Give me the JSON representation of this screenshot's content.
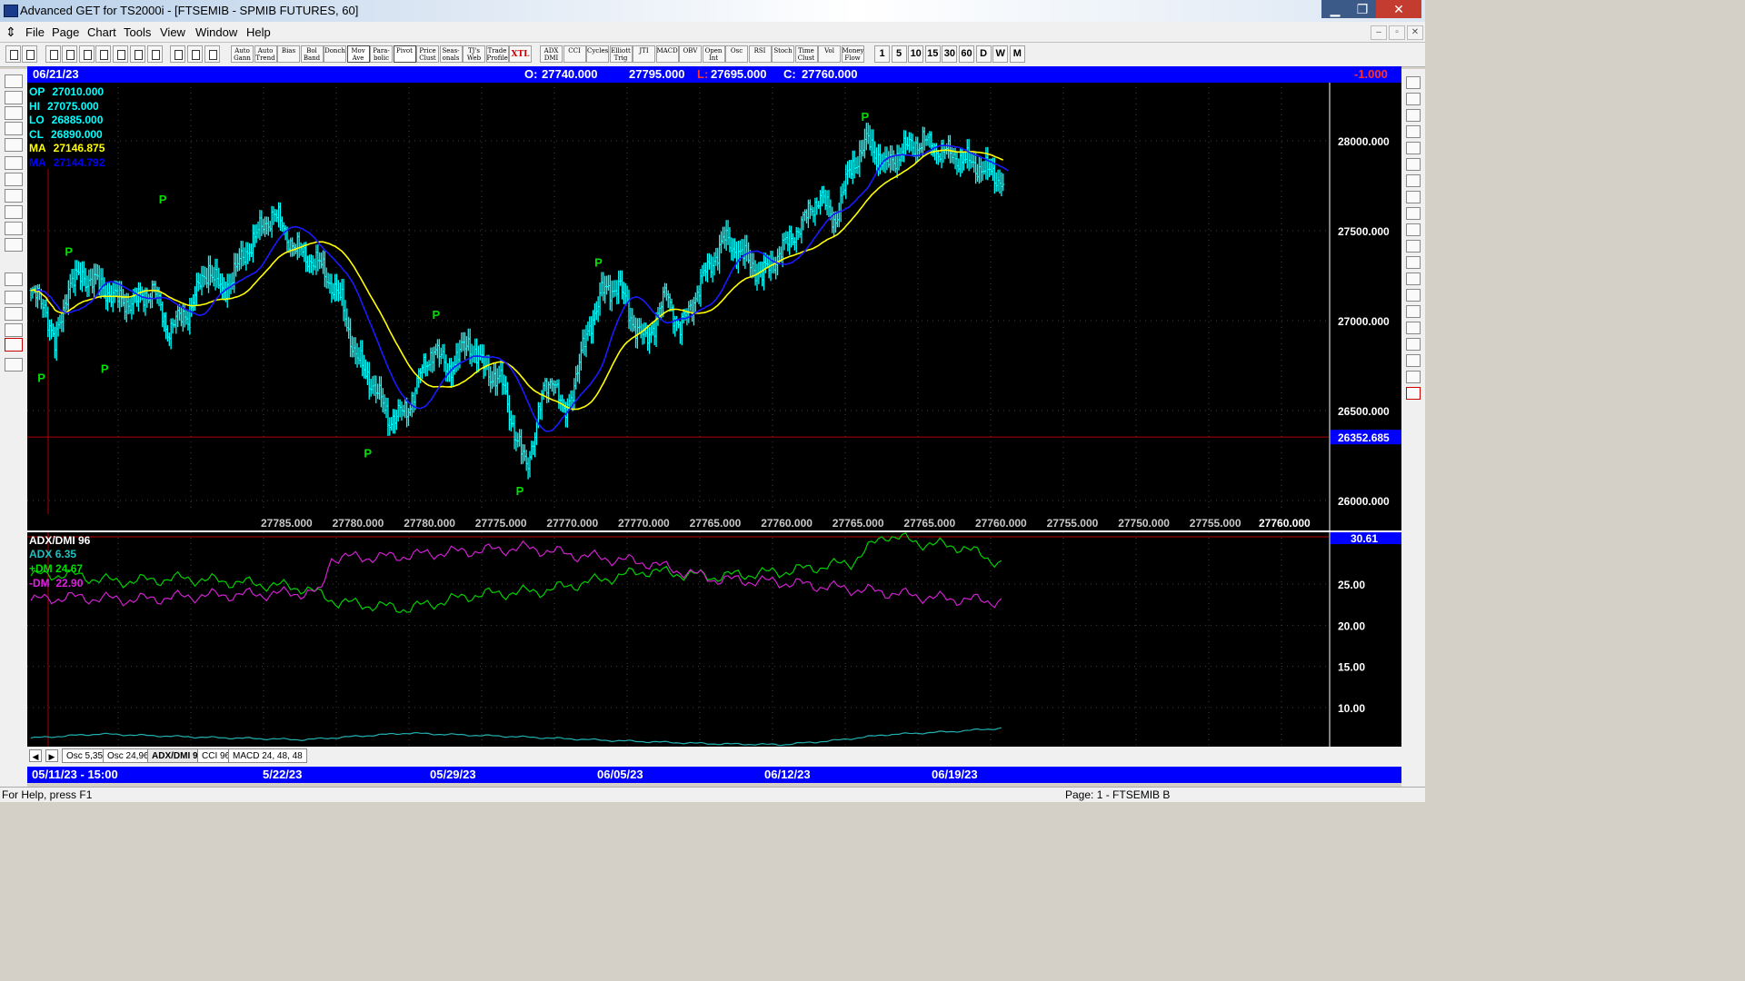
{
  "window": {
    "title": "Advanced GET for TS2000i - [FTSEMIB - SPMIB FUTURES, 60]",
    "minimize": "▁",
    "maximize": "❐",
    "close": "✕"
  },
  "menu": [
    "File",
    "Page",
    "Chart",
    "Tools",
    "View",
    "Window",
    "Help"
  ],
  "mdi_controls": [
    "–",
    "▫",
    "✕"
  ],
  "toolbar": {
    "study_buttons": [
      {
        "lines": [
          "Auto",
          "Gann"
        ]
      },
      {
        "lines": [
          "Auto",
          "Trend"
        ]
      },
      {
        "lines": [
          "Bias"
        ]
      },
      {
        "lines": [
          "Bol",
          "Band"
        ]
      },
      {
        "lines": [
          "Donch"
        ]
      },
      {
        "lines": [
          "Mov",
          "Ave"
        ],
        "selected": true
      },
      {
        "lines": [
          "Para-",
          "bolic"
        ]
      },
      {
        "lines": [
          "Pivot"
        ],
        "selected": true
      },
      {
        "lines": [
          "Price",
          "Clust"
        ]
      },
      {
        "lines": [
          "Seas-",
          "onals"
        ]
      },
      {
        "lines": [
          "TJ's",
          "Web"
        ]
      },
      {
        "lines": [
          "Trade",
          "Profile"
        ]
      },
      {
        "lines": [
          "XTL"
        ],
        "color": "#cc0000"
      }
    ],
    "indicator_buttons": [
      {
        "lines": [
          "ADX",
          "DMI"
        ]
      },
      {
        "lines": [
          "CCI"
        ]
      },
      {
        "lines": [
          "Cycles"
        ]
      },
      {
        "lines": [
          "Elliott",
          "Trig"
        ]
      },
      {
        "lines": [
          "JTI"
        ]
      },
      {
        "lines": [
          "MACD"
        ]
      },
      {
        "lines": [
          "OBV"
        ]
      },
      {
        "lines": [
          "Open",
          "Int"
        ]
      },
      {
        "lines": [
          "Osc"
        ]
      },
      {
        "lines": [
          "RSI"
        ]
      },
      {
        "lines": [
          "Stoch"
        ]
      },
      {
        "lines": [
          "Time",
          "Clust"
        ]
      },
      {
        "lines": [
          "Vol"
        ]
      },
      {
        "lines": [
          "Money",
          "Flow"
        ]
      }
    ],
    "timeframes": [
      {
        "label": "1"
      },
      {
        "label": "5"
      },
      {
        "label": "10"
      },
      {
        "label": "15"
      },
      {
        "label": "30"
      },
      {
        "label": "60",
        "selected": true
      },
      {
        "label": "D"
      },
      {
        "label": "W"
      },
      {
        "label": "M"
      }
    ]
  },
  "header": {
    "date": "06/21/23",
    "open_label": "O:",
    "open": "27740.000",
    "high": "27795.000",
    "low_label": "L:",
    "low": "27695.000",
    "close_label": "C:",
    "close": "27760.000",
    "change": "-1.000"
  },
  "readout": [
    {
      "label": "OP",
      "value": "27010.000",
      "color": "#00ffff"
    },
    {
      "label": "HI",
      "value": "27075.000",
      "color": "#00ffff"
    },
    {
      "label": "LO",
      "value": "26885.000",
      "color": "#00ffff"
    },
    {
      "label": "CL",
      "value": "26890.000",
      "color": "#00ffff"
    },
    {
      "label": "MA",
      "value": "27146.875",
      "color": "#ffff00"
    },
    {
      "label": "MA",
      "value": "27144.792",
      "color": "#0000ff"
    }
  ],
  "price_axis": {
    "ticks": [
      "28000.000",
      "27500.000",
      "27000.000",
      "26500.000",
      "26000.000"
    ],
    "cursor_price": "26352.685"
  },
  "bottom_values": [
    "27785.000",
    "27780.000",
    "27780.000",
    "27775.000",
    "27770.000",
    "27770.000",
    "27765.000",
    "27760.000",
    "27765.000",
    "27765.000",
    "27760.000",
    "27755.000",
    "27750.000",
    "27755.000"
  ],
  "bottom_value_current": "27760.000",
  "pivot_marker": "P",
  "adx": {
    "title": "ADX/DMI 96",
    "adx_label": "ADX",
    "adx_value": "6.35",
    "pdm_label": "+DM",
    "pdm_value": "24.67",
    "mdm_label": "-DM",
    "mdm_value": "22.90",
    "axis_ticks": [
      "30.61",
      "25.00",
      "20.00",
      "15.00",
      "10.00"
    ]
  },
  "tabs": [
    "Osc 5,35",
    "Osc 24,96",
    "ADX/DMI 96",
    "CCI 96",
    "MACD 24, 48, 48"
  ],
  "active_tab": "ADX/DMI 96",
  "time_axis": {
    "first": "05/11/23 - 15:00",
    "labels": [
      "5/22/23",
      "05/29/23",
      "06/05/23",
      "06/12/23",
      "06/19/23"
    ]
  },
  "statusbar": {
    "help": "For Help, press F1",
    "page": "Page: 1 - FTSEMIB B"
  },
  "colors": {
    "bars": "#00ffff",
    "ma_fast": "#ffff00",
    "ma_slow": "#1a1aff",
    "pivots": "#00e000",
    "adx": "#20b0b0",
    "plus_dm": "#00d000",
    "minus_dm": "#d020d0",
    "cursor_line": "#b00000"
  },
  "chart_data": {
    "type": "bar",
    "ohlc_keyframes": [
      [
        27150,
        0
      ],
      [
        27100,
        8
      ],
      [
        26850,
        14
      ],
      [
        27200,
        22
      ],
      [
        27250,
        30
      ],
      [
        27200,
        40
      ],
      [
        27120,
        50
      ],
      [
        27100,
        60
      ],
      [
        27180,
        72
      ],
      [
        26950,
        80
      ],
      [
        27050,
        92
      ],
      [
        27300,
        104
      ],
      [
        27150,
        112
      ],
      [
        27450,
        130
      ],
      [
        27600,
        142
      ],
      [
        27400,
        155
      ],
      [
        27300,
        170
      ],
      [
        27100,
        182
      ],
      [
        26800,
        190
      ],
      [
        26650,
        200
      ],
      [
        26450,
        210
      ],
      [
        26500,
        220
      ],
      [
        26700,
        228
      ],
      [
        26850,
        236
      ],
      [
        26720,
        244
      ],
      [
        26880,
        256
      ],
      [
        26750,
        264
      ],
      [
        26650,
        276
      ],
      [
        26350,
        284
      ],
      [
        26180,
        290
      ],
      [
        26600,
        300
      ],
      [
        26700,
        306
      ],
      [
        26450,
        312
      ],
      [
        26800,
        322
      ],
      [
        27000,
        328
      ],
      [
        27150,
        334
      ],
      [
        27200,
        344
      ],
      [
        27000,
        352
      ],
      [
        26880,
        360
      ],
      [
        27150,
        372
      ],
      [
        26950,
        380
      ],
      [
        27250,
        394
      ],
      [
        27450,
        406
      ],
      [
        27350,
        418
      ],
      [
        27250,
        428
      ],
      [
        27400,
        440
      ],
      [
        27550,
        452
      ],
      [
        27700,
        462
      ],
      [
        27550,
        470
      ],
      [
        27850,
        480
      ],
      [
        28000,
        490
      ],
      [
        27850,
        500
      ],
      [
        27950,
        510
      ],
      [
        28000,
        522
      ],
      [
        27950,
        532
      ],
      [
        27900,
        544
      ],
      [
        27850,
        556
      ],
      [
        27780,
        568
      ]
    ],
    "y_range": [
      25900,
      28100
    ],
    "pivots": [
      {
        "bar": 6,
        "price": 26750,
        "type": "low"
      },
      {
        "bar": 22,
        "price": 27330,
        "type": "high"
      },
      {
        "bar": 43,
        "price": 26800,
        "type": "low"
      },
      {
        "bar": 77,
        "price": 27620,
        "type": "high"
      },
      {
        "bar": 197,
        "price": 26330,
        "type": "low"
      },
      {
        "bar": 237,
        "price": 26980,
        "type": "high"
      },
      {
        "bar": 286,
        "price": 26120,
        "type": "low"
      },
      {
        "bar": 332,
        "price": 27270,
        "type": "high"
      },
      {
        "bar": 488,
        "price": 28080,
        "type": "high"
      }
    ],
    "adx_series": {
      "y_range": [
        5.2,
        31
      ],
      "plus_dm": [
        [
          0,
          26
        ],
        [
          20,
          26.2
        ],
        [
          50,
          25.3
        ],
        [
          90,
          25.7
        ],
        [
          140,
          24.9
        ],
        [
          160,
          24.5
        ],
        [
          180,
          22.8
        ],
        [
          220,
          22
        ],
        [
          260,
          23.7
        ],
        [
          300,
          24.2
        ],
        [
          330,
          25.4
        ],
        [
          360,
          26.6
        ],
        [
          400,
          25.9
        ],
        [
          440,
          26.5
        ],
        [
          480,
          27.6
        ],
        [
          500,
          31
        ],
        [
          520,
          30
        ],
        [
          545,
          29.5
        ],
        [
          568,
          27.5
        ]
      ],
      "minus_dm": [
        [
          0,
          23
        ],
        [
          20,
          23.4
        ],
        [
          60,
          23.1
        ],
        [
          100,
          23.6
        ],
        [
          140,
          23.8
        ],
        [
          170,
          24
        ],
        [
          175,
          28.2
        ],
        [
          210,
          28.3
        ],
        [
          240,
          28.8
        ],
        [
          290,
          29.4
        ],
        [
          320,
          28.5
        ],
        [
          360,
          27.6
        ],
        [
          400,
          25.6
        ],
        [
          440,
          25.2
        ],
        [
          470,
          24.6
        ],
        [
          500,
          24
        ],
        [
          530,
          23.3
        ],
        [
          568,
          22.9
        ]
      ],
      "adx": [
        [
          0,
          6.3
        ],
        [
          40,
          6.8
        ],
        [
          100,
          6.4
        ],
        [
          160,
          6.1
        ],
        [
          220,
          6.9
        ],
        [
          280,
          6.5
        ],
        [
          340,
          6
        ],
        [
          400,
          5.6
        ],
        [
          440,
          5.5
        ],
        [
          470,
          6
        ],
        [
          500,
          6.7
        ],
        [
          540,
          7.1
        ],
        [
          568,
          7.5
        ]
      ]
    }
  }
}
